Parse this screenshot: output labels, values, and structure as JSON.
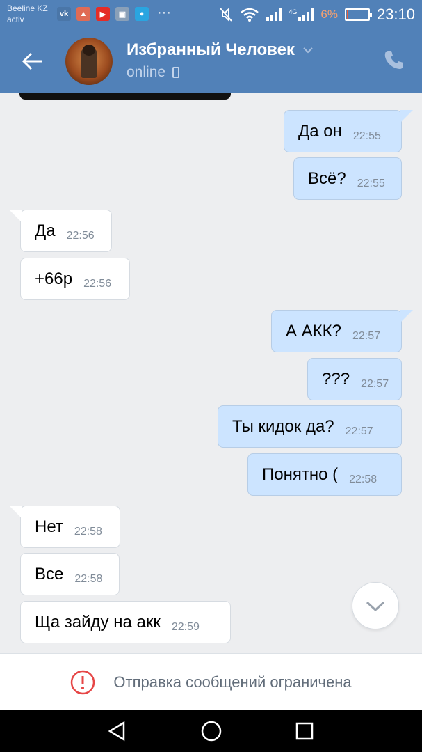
{
  "status_bar": {
    "carrier_line1": "Beeline KZ",
    "carrier_line2": "activ",
    "apps": [
      "vk-icon",
      "notification-icon",
      "youtube-icon",
      "gallery-icon",
      "chat-icon"
    ],
    "more": "···",
    "signal_label": "4G",
    "battery_percent": "6%",
    "battery_level": 0.06,
    "time": "23:10"
  },
  "header": {
    "title": "Избранный Человек",
    "status": "online"
  },
  "messages": [
    {
      "dir": "out",
      "text": "Да он",
      "time": "22:55"
    },
    {
      "dir": "out",
      "text": "Всё?",
      "time": "22:55"
    },
    {
      "dir": "in",
      "text": "Да",
      "time": "22:56"
    },
    {
      "dir": "in",
      "text": "+66р",
      "time": "22:56"
    },
    {
      "dir": "out",
      "text": "А АКК?",
      "time": "22:57"
    },
    {
      "dir": "out",
      "text": "???",
      "time": "22:57"
    },
    {
      "dir": "out",
      "text": "Ты кидок да?",
      "time": "22:57"
    },
    {
      "dir": "out",
      "text": "Понятно (",
      "time": "22:58"
    },
    {
      "dir": "in",
      "text": "Нет",
      "time": "22:58"
    },
    {
      "dir": "in",
      "text": "Все",
      "time": "22:58"
    },
    {
      "dir": "in",
      "text": "Ща зайду на акк",
      "time": "22:59"
    }
  ],
  "restriction": {
    "text": "Отправка сообщений ограничена"
  },
  "colors": {
    "header": "#5181b8",
    "bubble_out": "#cce4ff",
    "bubble_in": "#ffffff",
    "alert": "#e64646"
  }
}
